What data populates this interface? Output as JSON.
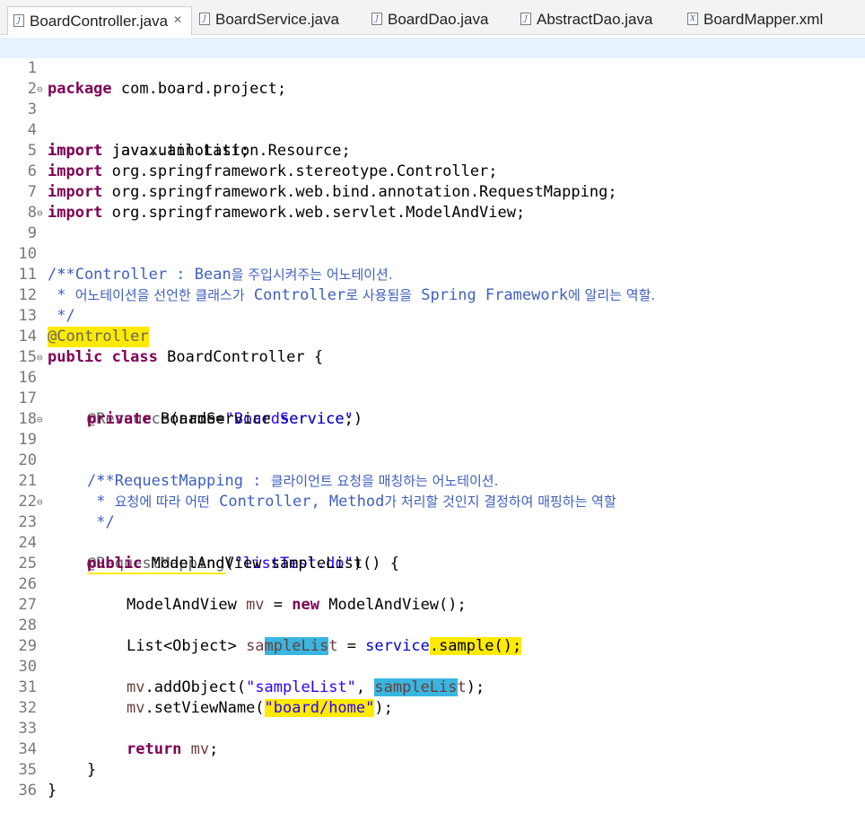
{
  "tabs": [
    {
      "label": "BoardController.java",
      "active": true,
      "closable": true,
      "icon": "java-file-icon"
    },
    {
      "label": "BoardService.java",
      "active": false,
      "icon": "java-file-icon"
    },
    {
      "label": "BoardDao.java",
      "active": false,
      "icon": "java-file-icon"
    },
    {
      "label": "AbstractDao.java",
      "active": false,
      "icon": "java-file-icon"
    },
    {
      "label": "BoardMapper.xml",
      "active": false,
      "icon": "xml-file-icon"
    }
  ],
  "close_glyph": "✕",
  "colors": {
    "keyword": "#7f0055",
    "string": "#2a00ff",
    "annotation": "#646464",
    "javadoc": "#3f5fbf",
    "field": "#0000c0",
    "local_variable": "#6a3e3e",
    "highlight_yellow": "#ffea00",
    "highlight_blue": "#38b6e0"
  },
  "code": {
    "line_numbers": [
      "1",
      "2",
      "3",
      "4",
      "5",
      "6",
      "7",
      "8",
      "9",
      "10",
      "11",
      "12",
      "13",
      "14",
      "15",
      "16",
      "17",
      "18",
      "19",
      "20",
      "21",
      "22",
      "23",
      "24",
      "25",
      "26",
      "27",
      "28",
      "29",
      "30",
      "31",
      "32",
      "33",
      "34",
      "35",
      "36"
    ],
    "fold_glyph": "⊖",
    "l1": {
      "kw": "package",
      "rest": " com.board.project;"
    },
    "l3": {
      "kw": "import",
      "rest": " java.util.List;"
    },
    "l4": {
      "kw": "import",
      "rest": " javax.annotation.Resource;"
    },
    "l5": {
      "kw": "import",
      "rest": " org.springframework.stereotype.Controller;"
    },
    "l6": {
      "kw": "import",
      "rest": " org.springframework.web.bind.annotation.RequestMapping;"
    },
    "l7": {
      "kw": "import",
      "rest": " org.springframework.web.servlet.ModelAndView;"
    },
    "l9": "/**",
    "l10": {
      "prefix": " * Controller : Bean",
      "korean": "을 주입시켜주는 어노테이션."
    },
    "l11": {
      "prefix": " * ",
      "k1": "어노테이션을 선언한 클래스가",
      "m1": " Controller",
      "k2": "로 사용됨을",
      "m2": " Spring Framework",
      "k3": "에 알리는 역할."
    },
    "l12": " */",
    "l13": "@Controller",
    "l14": {
      "kw1": "public",
      "kw2": "class",
      "rest": " BoardController {"
    },
    "l16": {
      "ann": "@Resource",
      "open": "(name=",
      "str": "\"BoardService\"",
      "close": ")"
    },
    "l17": {
      "kw": "private",
      "type": " BoardService ",
      "field": "service",
      "end": ";"
    },
    "l19": "/**",
    "l20": {
      "prefix": " * RequestMapping : ",
      "korean": "클라이언트 요청을 매칭하는 어노테이션."
    },
    "l21": {
      "prefix": " * ",
      "k1": "요청에 따라 어떤",
      "m1": " Controller, Method",
      "k2": "가 처리할 것인지 결정하여 매핑하는 역할"
    },
    "l22": " */",
    "l23": {
      "ann": "@RequestMapping",
      "open": "(",
      "str": "\"listTest.do\"",
      "close": ")"
    },
    "l24": {
      "kw": "public",
      "rest": " ModelAndView sampleList() {"
    },
    "l26": {
      "type": "ModelAndView ",
      "var": "mv",
      "eq": " = ",
      "kw": "new",
      "rest": " ModelAndView();"
    },
    "l28": {
      "type": "List<Object> ",
      "var_a": "sa",
      "var_b": "mpleLis",
      "var_c": "t",
      "eq": " = ",
      "field": "service",
      "call": ".sample();"
    },
    "l30": {
      "var": "mv",
      "call": ".addObject(",
      "str": "\"sampleList\"",
      "comma": ", ",
      "arg_a": "sampleLis",
      "arg_b": "t",
      "close": ");"
    },
    "l31": {
      "var": "mv",
      "call": ".setViewName(",
      "str": "\"board/home\"",
      "close": ");"
    },
    "l33": {
      "kw": "return",
      "sp": " ",
      "var": "mv",
      "end": ";"
    },
    "l34": "}",
    "l35": "}"
  }
}
